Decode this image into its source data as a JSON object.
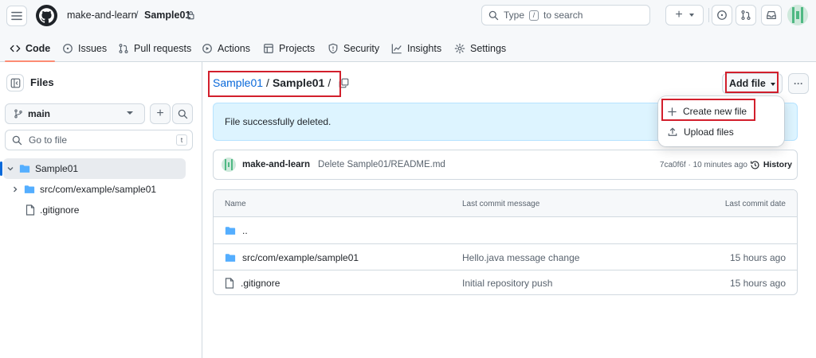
{
  "header": {
    "owner": "make-and-learn",
    "separator": "/",
    "repo": "Sample01",
    "search_placeholder_pre": "Type",
    "search_key": "/",
    "search_placeholder_post": "to search",
    "plus": "+"
  },
  "tabs": [
    {
      "label": "Code",
      "icon": "code-icon"
    },
    {
      "label": "Issues",
      "icon": "issue-icon"
    },
    {
      "label": "Pull requests",
      "icon": "pull-request-icon"
    },
    {
      "label": "Actions",
      "icon": "play-icon"
    },
    {
      "label": "Projects",
      "icon": "table-icon"
    },
    {
      "label": "Security",
      "icon": "shield-icon"
    },
    {
      "label": "Insights",
      "icon": "graph-icon"
    },
    {
      "label": "Settings",
      "icon": "gear-icon"
    }
  ],
  "sidebar": {
    "title": "Files",
    "branch": "main",
    "goto_placeholder": "Go to file",
    "goto_key": "t",
    "tree": [
      {
        "label": "Sample01",
        "type": "folder",
        "expanded": true
      },
      {
        "label": "src/com/example/sample01",
        "type": "folder",
        "expanded": false
      },
      {
        "label": ".gitignore",
        "type": "file"
      }
    ]
  },
  "main": {
    "breadcrumb_root": "Sample01",
    "breadcrumb_sep": "/",
    "breadcrumb_current": "Sample01",
    "breadcrumb_trail": "/",
    "add_file_label": "Add file",
    "more_label": "···",
    "flash": "File successfully deleted.",
    "dropdown": [
      {
        "label": "Create new file",
        "icon": "plus-icon"
      },
      {
        "label": "Upload files",
        "icon": "upload-icon"
      }
    ],
    "commit": {
      "author": "make-and-learn",
      "message": "Delete Sample01/README.md",
      "sha": "7ca0f6f",
      "dot": " · ",
      "time": "10 minutes ago",
      "history_label": "History"
    },
    "table": {
      "columns": [
        "Name",
        "Last commit message",
        "Last commit date"
      ],
      "rows": [
        {
          "name": "..",
          "type": "folder",
          "message": "",
          "date": ""
        },
        {
          "name": "src/com/example/sample01",
          "type": "folder",
          "message": "Hello.java message change",
          "date": "15 hours ago"
        },
        {
          "name": ".gitignore",
          "type": "file",
          "message": "Initial repository push",
          "date": "15 hours ago"
        }
      ]
    }
  },
  "colors": {
    "accent": "#0969da",
    "highlight": "#d21f2c",
    "folder": "#54aeff",
    "tab_underline": "#fd8c73",
    "flash_bg": "#ddf4ff"
  }
}
